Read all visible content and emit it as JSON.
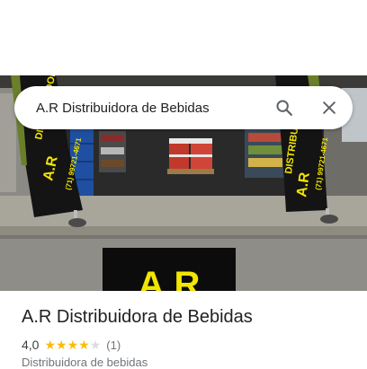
{
  "search": {
    "value": "A.R Distribuidora de Bebidas",
    "search_icon": "search-icon",
    "close_icon": "close-icon"
  },
  "photo": {
    "logo_text": "A.R",
    "banner_left_name": "DISTRIBUIDORA",
    "banner_right_name": "DISTRIBUIDORA",
    "banner_brand": "A.R",
    "banner_phone": "(71) 99721-4671"
  },
  "place": {
    "title": "A.R Distribuidora de Bebidas",
    "rating": "4,0",
    "rating_value": 4,
    "rating_max": 5,
    "review_count": "(1)",
    "category": "Distribuidora de bebidas"
  },
  "colors": {
    "star_filled": "#fbbc04",
    "star_empty": "#dadce0",
    "logo_yellow": "#f2e600"
  }
}
